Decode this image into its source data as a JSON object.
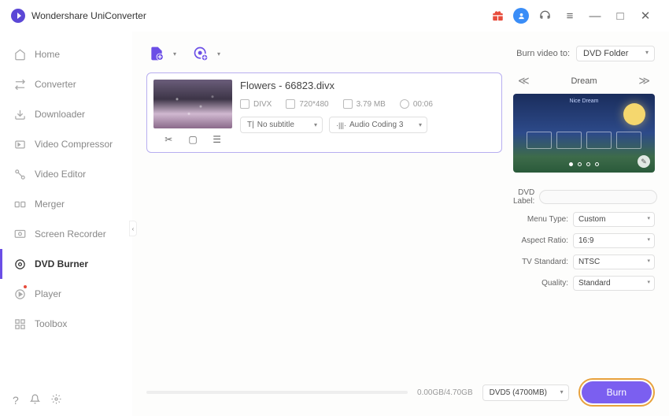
{
  "app": {
    "title": "Wondershare UniConverter"
  },
  "sidebar": {
    "items": [
      {
        "label": "Home"
      },
      {
        "label": "Converter"
      },
      {
        "label": "Downloader"
      },
      {
        "label": "Video Compressor"
      },
      {
        "label": "Video Editor"
      },
      {
        "label": "Merger"
      },
      {
        "label": "Screen Recorder"
      },
      {
        "label": "DVD Burner"
      },
      {
        "label": "Player"
      },
      {
        "label": "Toolbox"
      }
    ],
    "active_index": 7
  },
  "burn_to": {
    "label": "Burn video to:",
    "value": "DVD Folder"
  },
  "file": {
    "name": "Flowers - 66823.divx",
    "format": "DIVX",
    "resolution": "720*480",
    "size": "3.79 MB",
    "duration": "00:06",
    "subtitle": "No subtitle",
    "audio": "Audio Coding 3"
  },
  "template": {
    "name": "Dream",
    "title": "Nice Dream"
  },
  "settings": {
    "dvd_label": {
      "label": "DVD Label:",
      "value": ""
    },
    "menu_type": {
      "label": "Menu Type:",
      "value": "Custom"
    },
    "aspect_ratio": {
      "label": "Aspect Ratio:",
      "value": "16:9"
    },
    "tv_standard": {
      "label": "TV Standard:",
      "value": "NTSC"
    },
    "quality": {
      "label": "Quality:",
      "value": "Standard"
    }
  },
  "footer": {
    "size": "0.00GB/4.70GB",
    "disc": "DVD5 (4700MB)",
    "burn_label": "Burn"
  }
}
